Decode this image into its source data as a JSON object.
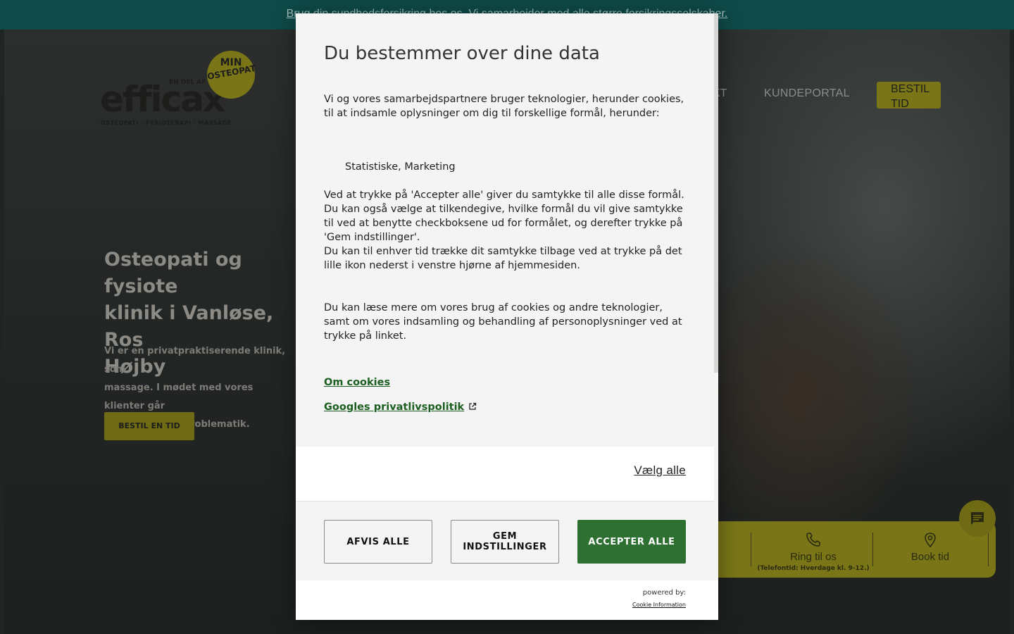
{
  "site": {
    "topbar_text": "Brug din sundhedsforsikring hos os. Vi samarbejder med alle større forsikringsselskaber.",
    "logo": {
      "wordmark": "efficax",
      "tagline": "OSTEOPATI · FYSIOTERAPI · MASSAGE",
      "part_of": "EN DEL AF",
      "badge_top": "MIN",
      "badge_bottom": "OSTEOPAT"
    },
    "nav": {
      "kontakt_fragment": "KT",
      "kundeportal": "KUNDEPORTAL",
      "bestil_tid": "BESTIL\nTID"
    },
    "hero": {
      "title": "Osteopati og fysiote\nklinik i Vanløse, Ros\nHøjby",
      "text": " Vi er en privatpraktiserende klinik, som\nmassage. I mødet med vores klienter går\ndin skade eller problematik.",
      "button": "BESTIL EN TID"
    },
    "cta": {
      "call_label": "Ring til os",
      "call_hours": "(Telefontid: Hverdage kl. 9-12.)",
      "book_label": "Book tid"
    },
    "icons": {
      "phone": "phone-icon",
      "pin": "map-pin-icon",
      "chat": "chat-icon",
      "external": "external-link-icon"
    },
    "colors": {
      "topbar": "#0e4a48",
      "brand_yellow": "#d8d200",
      "accept_green": "#2e6f32",
      "link_green": "#1b5e20"
    }
  },
  "consent": {
    "title": "Du bestemmer over dine data",
    "intro": "Vi og vores samarbejdspartnere bruger teknologier, herunder cookies, til at indsamle oplysninger om dig til forskellige formål, herunder:",
    "purposes": "Statistiske, Marketing",
    "explanation": "Ved at trykke på 'Accepter alle' giver du samtykke til alle disse formål. Du kan også vælge at tilkendegive, hvilke formål du vil give samtykke til ved at benytte checkboksene ud for formålet, og derefter trykke på 'Gem indstillinger'.",
    "withdraw": "Du kan til enhver tid trække dit samtykke tilbage ved at trykke på det lille ikon nederst i venstre hjørne af hjemmesiden.",
    "more_info": "Du kan læse mere om vores brug af cookies og andre teknologier, samt om vores indsamling og behandling af personoplysninger ved at trykke på linket.",
    "link_cookies": "Om cookies",
    "link_google": "Googles privatlivspolitik",
    "select_all": "Vælg alle",
    "btn_reject": "AFVIS ALLE",
    "btn_save": "GEM\nINDSTILLINGER",
    "btn_accept": "ACCEPTER ALLE",
    "powered_by": "powered by:",
    "powered_link": "Cookie Information"
  }
}
